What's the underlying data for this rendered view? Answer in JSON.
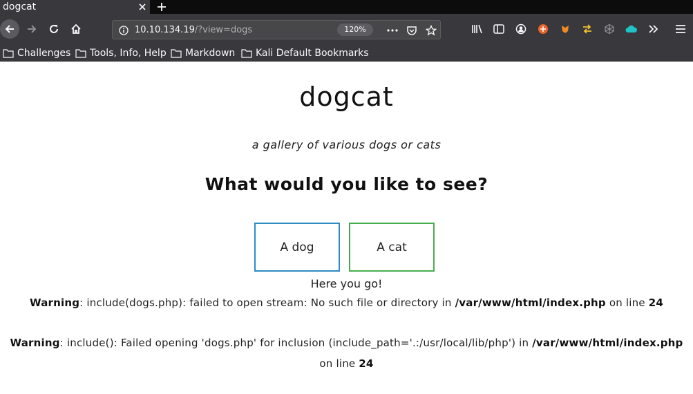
{
  "tab": {
    "title": "dogcat"
  },
  "url": {
    "host": "10.10.134.19",
    "path": "/?view=dogs",
    "zoom": "120%"
  },
  "bookmarks": [
    "Challenges",
    "Tools, Info, Help",
    "Markdown",
    "Kali Default Bookmarks"
  ],
  "page": {
    "title": "dogcat",
    "subtitle": "a gallery of various dogs or cats",
    "question": "What would you like to see?",
    "btn_dog": "A dog",
    "btn_cat": "A cat",
    "here": "Here you go!",
    "warn1": {
      "label": "Warning",
      "message": ": include(dogs.php): failed to open stream: No such file or directory in ",
      "file": "/var/www/html/index.php",
      "on_line": " on line ",
      "line": "24"
    },
    "warn2": {
      "label": "Warning",
      "message": ": include(): Failed opening 'dogs.php' for inclusion (include_path='.:/usr/local/lib/php') in ",
      "file": "/var/www/html/index.php",
      "on_line": "on line ",
      "line": "24"
    }
  },
  "colors": {
    "dog_border": "#2d8bc2",
    "cat_border": "#46ad4e",
    "chrome": "#38383d"
  }
}
